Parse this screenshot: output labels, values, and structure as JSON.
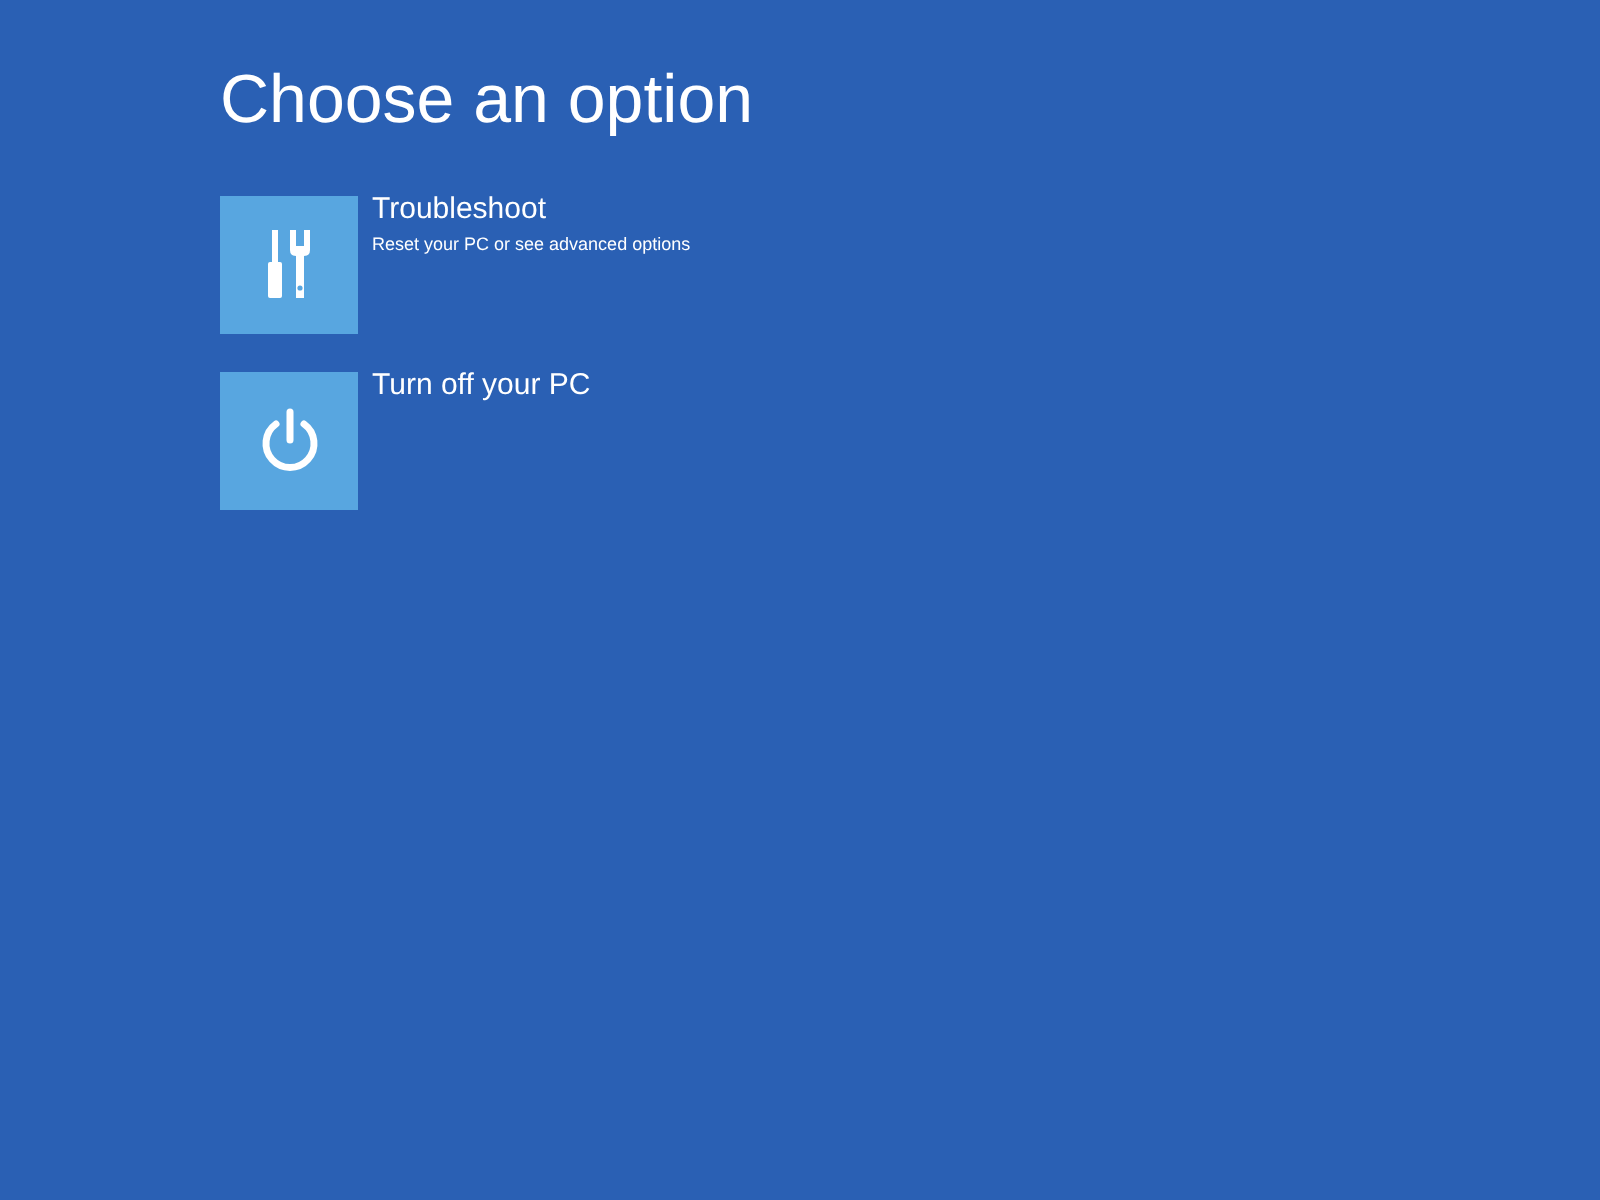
{
  "title": "Choose an option",
  "options": [
    {
      "kind": "tools",
      "label": "Troubleshoot",
      "description": "Reset your PC or see advanced options"
    },
    {
      "kind": "power",
      "label": "Turn off your PC"
    }
  ]
}
